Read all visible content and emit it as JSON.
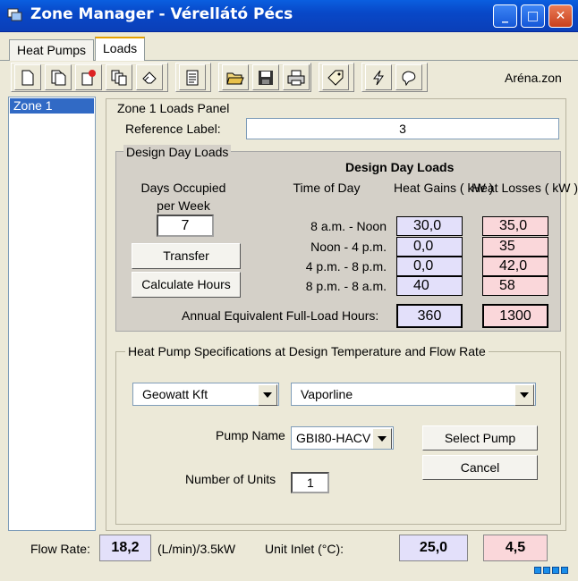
{
  "window": {
    "title": "Zone Manager  -  Vérellátó Pécs",
    "controls": [
      "minimize",
      "maximize",
      "close"
    ]
  },
  "tabs": [
    {
      "label": "Heat Pumps",
      "active": false
    },
    {
      "label": "Loads",
      "active": true
    }
  ],
  "toolbar": {
    "icons": [
      "new-icon",
      "copy-icon",
      "delete-icon",
      "duplicate-icon",
      "eraser-icon",
      "report-icon",
      "open-folder-icon",
      "save-icon",
      "print-icon",
      "tag-icon",
      "lightning-icon",
      "brain-icon"
    ],
    "file_name": "Aréna.zon"
  },
  "zone_list": {
    "items": [
      "Zone 1"
    ],
    "selected": "Zone 1"
  },
  "panel": {
    "title": "Zone 1 Loads Panel",
    "reference_label": "Reference Label:",
    "reference_value": "3"
  },
  "design_day": {
    "group_label": "Design Day Loads",
    "days_occupied_label": "Days Occupied per Week",
    "days_occupied_value": "7",
    "transfer_label": "Transfer",
    "calculate_label": "Calculate Hours",
    "table_title": "Design Day Loads",
    "col_time": "Time of Day",
    "col_gains": "Heat Gains ( kW )",
    "col_losses": "Heat Losses ( kW )",
    "rows": [
      {
        "time": "8 a.m. - Noon",
        "gain": "30,0",
        "loss": "35,0"
      },
      {
        "time": "Noon - 4 p.m.",
        "gain": "0,0",
        "loss": "35"
      },
      {
        "time": "4 p.m. - 8 p.m.",
        "gain": "0,0",
        "loss": "42,0"
      },
      {
        "time": "8 p.m. - 8 a.m.",
        "gain": "40",
        "loss": "58"
      }
    ],
    "annual_label": "Annual Equivalent Full-Load Hours:",
    "annual_gain": "360",
    "annual_loss": "1300"
  },
  "heat_pump": {
    "group_label": "Heat Pump Specifications at Design Temperature and Flow Rate",
    "manufacturer": "Geowatt Kft",
    "series": "Vaporline",
    "pump_name_label": "Pump Name",
    "pump_name": "GBI80-HACV",
    "select_label": "Select Pump",
    "cancel_label": "Cancel",
    "units_label": "Number of Units",
    "units_value": "1"
  },
  "status": {
    "flow_label": "Flow Rate:",
    "flow_value": "18,2",
    "flow_unit": "(L/min)/3.5kW",
    "inlet_label": "Unit Inlet (°C):",
    "inlet_heating": "25,0",
    "inlet_cooling": "4,5"
  },
  "colors": {
    "titlebar": "#0848C8",
    "selection": "#316AC5",
    "gain_fill": "#E3E0FA",
    "loss_fill": "#FAD7DA",
    "group_fill": "#D4D0C8"
  }
}
